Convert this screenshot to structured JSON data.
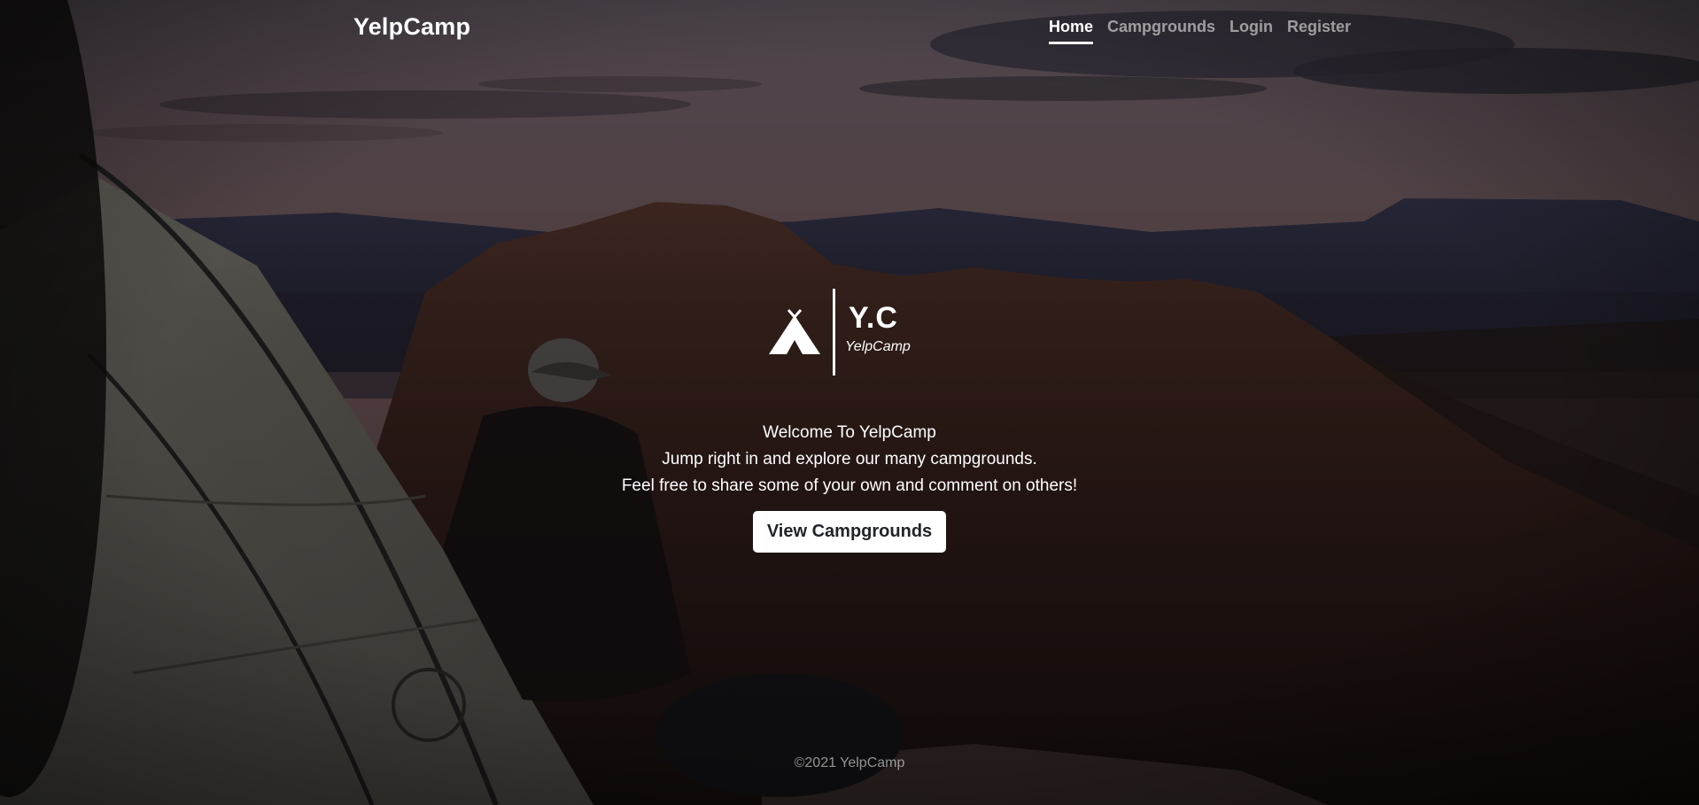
{
  "nav": {
    "brand": "YelpCamp",
    "links": [
      {
        "label": "Home",
        "active": true
      },
      {
        "label": "Campgrounds",
        "active": false
      },
      {
        "label": "Login",
        "active": false
      },
      {
        "label": "Register",
        "active": false
      }
    ]
  },
  "logo": {
    "initials": "Y.C",
    "name": "YelpCamp",
    "icon": "tent-icon"
  },
  "intro": {
    "line1": "Welcome To YelpCamp",
    "line2": "Jump right in and explore our many campgrounds.",
    "line3": "Feel free to share some of your own and comment on others!"
  },
  "cta": {
    "label": "View Campgrounds"
  },
  "footer": {
    "text": "©2021 YelpCamp"
  },
  "colors": {
    "text": "#ffffff",
    "button_bg": "#ffffff",
    "button_text": "#212529",
    "nav_inactive": "rgba(255,255,255,0.55)"
  }
}
